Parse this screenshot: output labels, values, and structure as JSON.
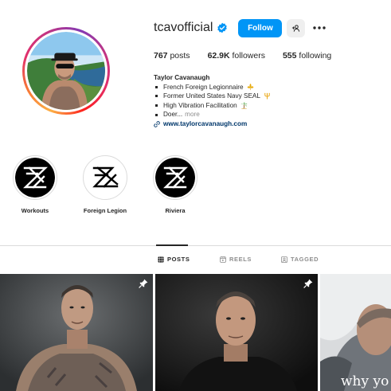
{
  "profile": {
    "username": "tcavofficial",
    "verified": true,
    "follow_label": "Follow",
    "stats": {
      "posts_count": "767",
      "posts_label": "posts",
      "followers_count": "62.9K",
      "followers_label": "followers",
      "following_count": "555",
      "following_label": "following"
    },
    "bio": {
      "name": "Taylor Cavanaugh",
      "lines": [
        {
          "text": "French Foreign Legionnaire",
          "emoji": "fleur-de-lis"
        },
        {
          "text": "Former United States Navy SEAL",
          "emoji": "trident"
        },
        {
          "text": "High Vibration Facilitation",
          "emoji": "palm-tree"
        }
      ],
      "truncated_line": "Doer...",
      "more_label": "more",
      "link": "www.taylorcavanaugh.com"
    }
  },
  "highlights": [
    {
      "label": "Workouts",
      "style": "black"
    },
    {
      "label": "Foreign Legion",
      "style": "white"
    },
    {
      "label": "Riviera",
      "style": "black"
    }
  ],
  "tabs": [
    {
      "label": "POSTS",
      "icon": "grid-icon",
      "active": true
    },
    {
      "label": "REELS",
      "icon": "reels-icon",
      "active": false
    },
    {
      "label": "TAGGED",
      "icon": "tagged-icon",
      "active": false
    }
  ],
  "posts": [
    {
      "pinned": true,
      "overlay_text": ""
    },
    {
      "pinned": true,
      "overlay_text": ""
    },
    {
      "pinned": false,
      "overlay_text": "why yo"
    }
  ],
  "colors": {
    "follow_button": "#0095f6",
    "link": "#00376b",
    "verified_badge": "#0095f6"
  }
}
